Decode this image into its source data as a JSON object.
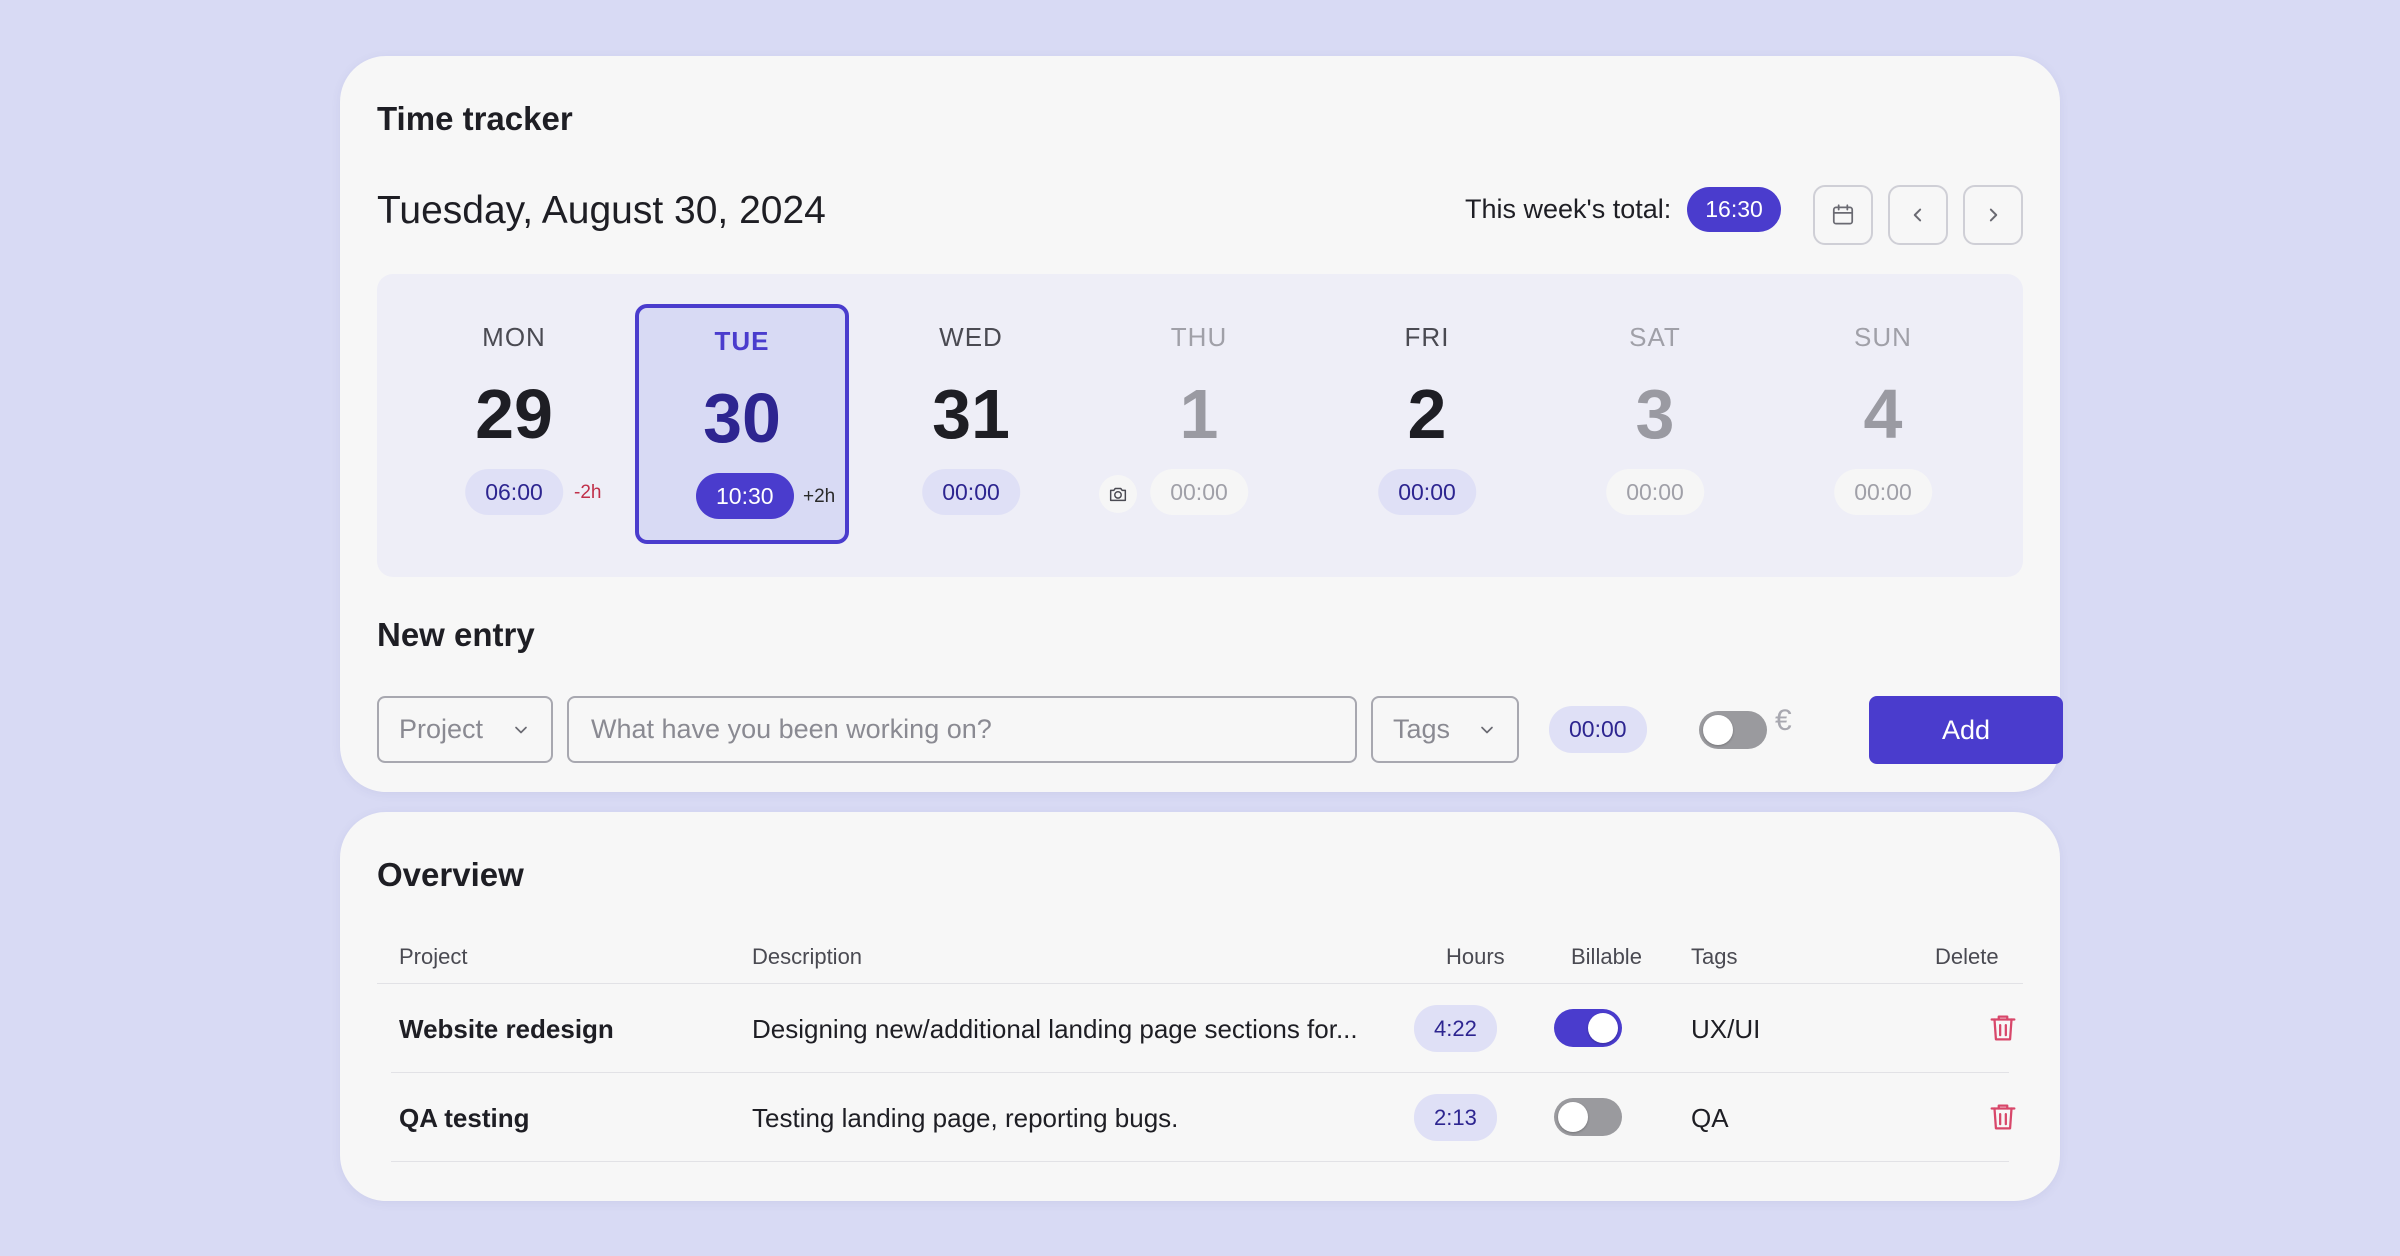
{
  "tracker": {
    "title": "Time tracker",
    "date": "Tuesday, August 30, 2024",
    "week_total_label": "This week's total:",
    "week_total_value": "16:30"
  },
  "days": [
    {
      "name": "MON",
      "num": "29",
      "hours": "06:00",
      "diff": "-2h"
    },
    {
      "name": "TUE",
      "num": "30",
      "hours": "10:30",
      "diff": "+2h"
    },
    {
      "name": "WED",
      "num": "31",
      "hours": "00:00"
    },
    {
      "name": "THU",
      "num": "1",
      "hours": "00:00"
    },
    {
      "name": "FRI",
      "num": "2",
      "hours": "00:00"
    },
    {
      "name": "SAT",
      "num": "3",
      "hours": "00:00"
    },
    {
      "name": "SUN",
      "num": "4",
      "hours": "00:00"
    }
  ],
  "new_entry": {
    "title": "New entry",
    "project_placeholder": "Project",
    "description_placeholder": "What have you been working on?",
    "tags_placeholder": "Tags",
    "hours": "00:00",
    "billable": false,
    "currency_symbol": "€",
    "add_label": "Add"
  },
  "overview": {
    "title": "Overview",
    "columns": [
      "Project",
      "Description",
      "Hours",
      "Billable",
      "Tags",
      "Delete"
    ],
    "rows": [
      {
        "project": "Website redesign",
        "description": "Designing new/additional landing page sections for...",
        "hours": "4:22",
        "billable": true,
        "tags": "UX/UI"
      },
      {
        "project": "QA testing",
        "description": "Testing landing page, reporting bugs.",
        "hours": "2:13",
        "billable": false,
        "tags": "QA"
      }
    ]
  },
  "colors": {
    "accent": "#4a3ccd",
    "background": "#d8daf4",
    "card": "#f7f7f7",
    "negative": "#c0304a"
  },
  "icons": {
    "calendar": "calendar-icon",
    "prev": "chevron-left-icon",
    "next": "chevron-right-icon",
    "camera": "camera-icon",
    "dropdown": "chevron-down-icon",
    "delete": "trash-icon"
  }
}
